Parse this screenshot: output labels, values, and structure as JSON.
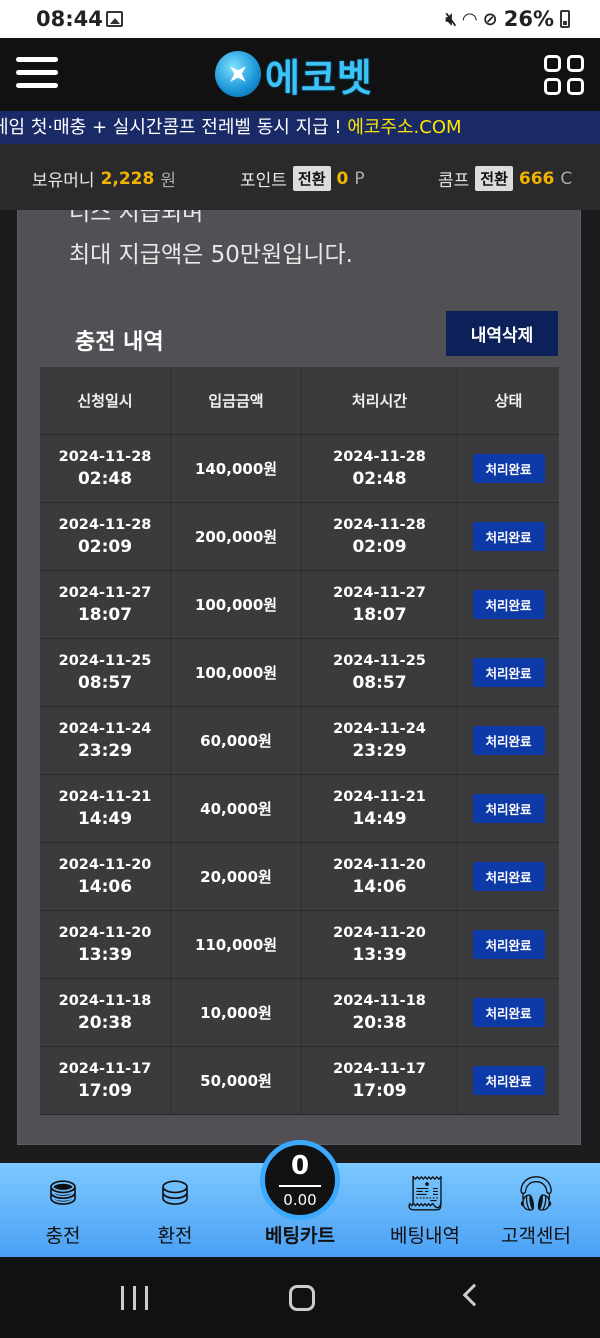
{
  "status_bar": {
    "time": "08:44",
    "battery": "26%"
  },
  "header": {
    "logo_text": "에코벳"
  },
  "marquee": {
    "text": "게임 첫·매충 + 실시간콤프 전레벨 동시 지급 ! ",
    "link": "에코주소.COM"
  },
  "money_bar": {
    "money_label": "보유머니",
    "money_value": "2,228",
    "money_unit": "원",
    "point_label": "포인트",
    "point_convert": "전환",
    "point_value": "0",
    "point_unit": "P",
    "comp_label": "콤프",
    "comp_convert": "전환",
    "comp_value": "666",
    "comp_unit": "C"
  },
  "notice": {
    "line1": "너스 지급되며",
    "line2": "최대 지급액은 50만원입니다."
  },
  "history": {
    "title": "충전 내역",
    "delete_label": "내역삭제",
    "columns": [
      "신청일시",
      "입금금액",
      "처리시간",
      "상태"
    ],
    "rows": [
      {
        "req_date": "2024-11-28",
        "req_time": "02:48",
        "amount": "140,000원",
        "proc_date": "2024-11-28",
        "proc_time": "02:48",
        "status": "처리완료"
      },
      {
        "req_date": "2024-11-28",
        "req_time": "02:09",
        "amount": "200,000원",
        "proc_date": "2024-11-28",
        "proc_time": "02:09",
        "status": "처리완료"
      },
      {
        "req_date": "2024-11-27",
        "req_time": "18:07",
        "amount": "100,000원",
        "proc_date": "2024-11-27",
        "proc_time": "18:07",
        "status": "처리완료"
      },
      {
        "req_date": "2024-11-25",
        "req_time": "08:57",
        "amount": "100,000원",
        "proc_date": "2024-11-25",
        "proc_time": "08:57",
        "status": "처리완료"
      },
      {
        "req_date": "2024-11-24",
        "req_time": "23:29",
        "amount": "60,000원",
        "proc_date": "2024-11-24",
        "proc_time": "23:29",
        "status": "처리완료"
      },
      {
        "req_date": "2024-11-21",
        "req_time": "14:49",
        "amount": "40,000원",
        "proc_date": "2024-11-21",
        "proc_time": "14:49",
        "status": "처리완료"
      },
      {
        "req_date": "2024-11-20",
        "req_time": "14:06",
        "amount": "20,000원",
        "proc_date": "2024-11-20",
        "proc_time": "14:06",
        "status": "처리완료"
      },
      {
        "req_date": "2024-11-20",
        "req_time": "13:39",
        "amount": "110,000원",
        "proc_date": "2024-11-20",
        "proc_time": "13:39",
        "status": "처리완료"
      },
      {
        "req_date": "2024-11-18",
        "req_time": "20:38",
        "amount": "10,000원",
        "proc_date": "2024-11-18",
        "proc_time": "20:38",
        "status": "처리완료"
      },
      {
        "req_date": "2024-11-17",
        "req_time": "17:09",
        "amount": "50,000원",
        "proc_date": "2024-11-17",
        "proc_time": "17:09",
        "status": "처리완료"
      }
    ]
  },
  "bottom_nav": {
    "items": [
      {
        "label": "충전",
        "icon": "deposit-coins-icon"
      },
      {
        "label": "환전",
        "icon": "withdraw-coins-icon"
      },
      {
        "label": "베팅내역",
        "icon": "receipt-icon"
      },
      {
        "label": "고객센터",
        "icon": "headset-icon"
      }
    ],
    "cart_count": "0",
    "cart_amount": "0.00",
    "cart_label": "베팅카트"
  }
}
